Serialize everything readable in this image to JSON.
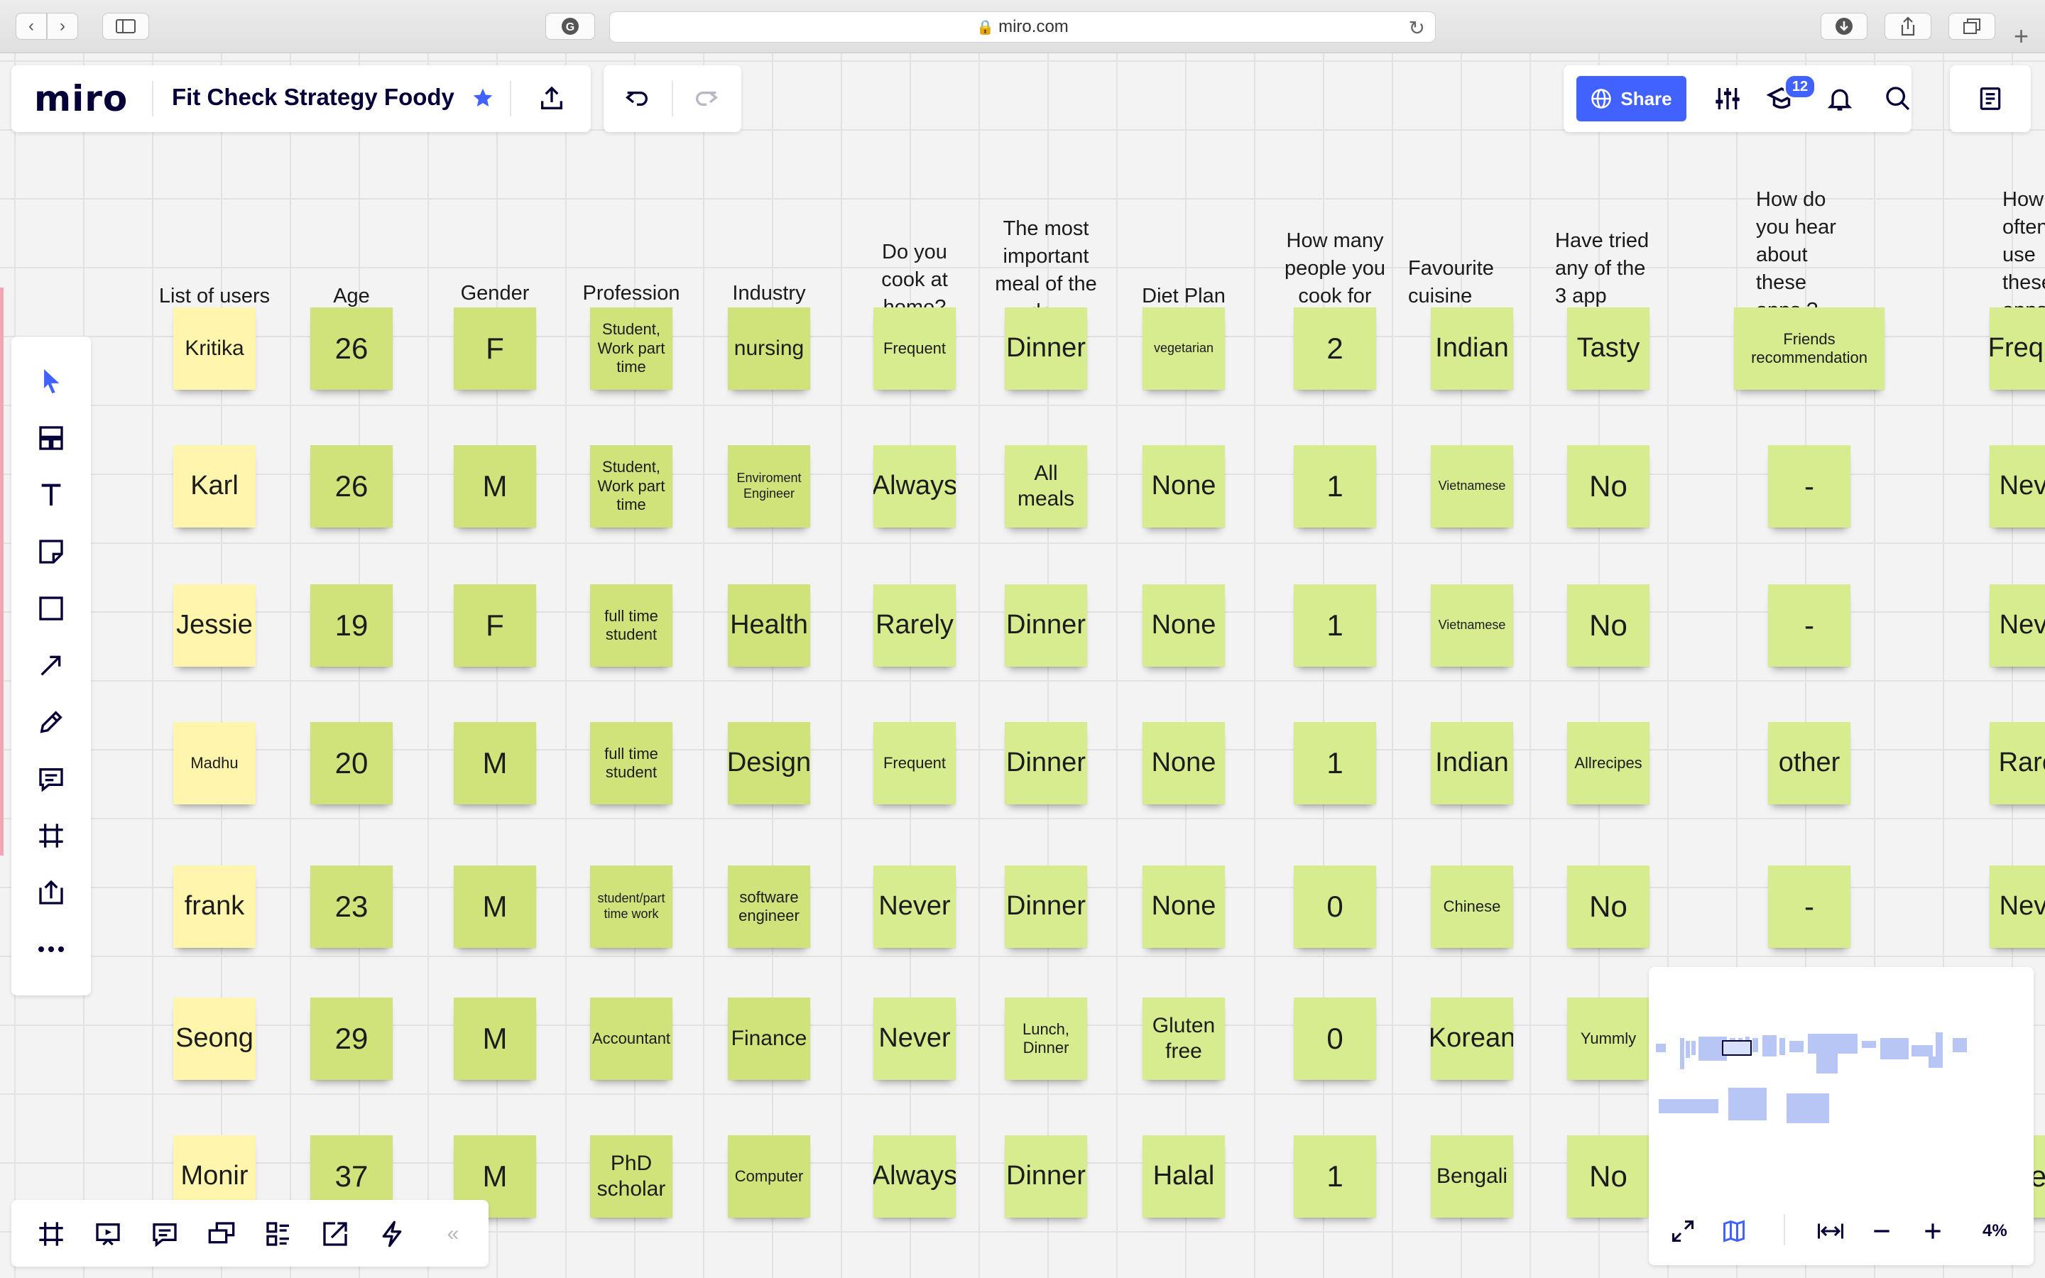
{
  "browser": {
    "url": "miro.com",
    "icons": [
      "back-icon",
      "forward-icon",
      "sidebar-icon",
      "extension-icon",
      "lock-icon",
      "reload-icon",
      "download-icon",
      "share-icon",
      "tabs-icon",
      "new-tab-icon"
    ]
  },
  "toolbar": {
    "logo": "miro",
    "board_title": "Fit Check Strategy Foody",
    "share_label": "Share",
    "notifications_count": "12",
    "zoom": "4%"
  },
  "colors": {
    "accent": "#4262ff",
    "sticky_green": "#d6ec8f",
    "sticky_yellow": "#fff5ad"
  },
  "headers": [
    "List of users",
    "Age",
    "Gender",
    "Profession",
    "Industry",
    "Do you cook at home?",
    "The most important meal of the day",
    "Diet Plan",
    "How many people you cook for",
    "Favourite cuisine",
    "Have tried any of the 3 app",
    "How do you hear about these apps.?",
    "How  often use these apps.?"
  ],
  "rows": [
    [
      "Kritika",
      "26",
      "F",
      "Student, Work part time",
      "nursing",
      "Frequent",
      "Dinner",
      "vegetarian",
      "2",
      "Indian",
      "Tasty",
      "Friends recommendation",
      "Freque"
    ],
    [
      "Karl",
      "26",
      "M",
      "Student, Work part time",
      "Enviroment Engineer",
      "Always",
      "All meals",
      "None",
      "1",
      "Vietnamese",
      "No",
      "-",
      "Neve"
    ],
    [
      "Jessie",
      "19",
      "F",
      "full time student",
      "Health",
      "Rarely",
      "Dinner",
      "None",
      "1",
      "Vietnamese",
      "No",
      "-",
      "Neve"
    ],
    [
      "Madhu",
      "20",
      "M",
      "full time student",
      "Design",
      "Frequent",
      "Dinner",
      "None",
      "1",
      "Indian",
      "Allrecipes",
      "other",
      "Rarel"
    ],
    [
      "frank",
      "23",
      "M",
      "student/part time work",
      "software engineer",
      "Never",
      "Dinner",
      "None",
      "0",
      "Chinese",
      "No",
      "-",
      "Neve"
    ],
    [
      "Seong",
      "29",
      "M",
      "Accountant",
      "Finance",
      "Never",
      "Lunch, Dinner",
      "Gluten free",
      "0",
      "Korean",
      "Yummly",
      "",
      ""
    ],
    [
      "Monir",
      "37",
      "M",
      "PhD scholar",
      "Computer",
      "Always",
      "Dinner",
      "Halal",
      "1",
      "Bengali",
      "No",
      "",
      "ve"
    ]
  ],
  "left_tools": [
    "select-tool",
    "templates-tool",
    "text-tool",
    "sticky-note-tool",
    "shape-tool",
    "arrow-tool",
    "pen-tool",
    "comment-tool",
    "frame-tool",
    "upload-tool",
    "more-tools"
  ],
  "bottom_tools": [
    "frames-tool",
    "presentation-tool",
    "comments-tool",
    "screen-share-tool",
    "cards-tool",
    "export-tool",
    "lightning-tool",
    "collapse-toolbar"
  ]
}
